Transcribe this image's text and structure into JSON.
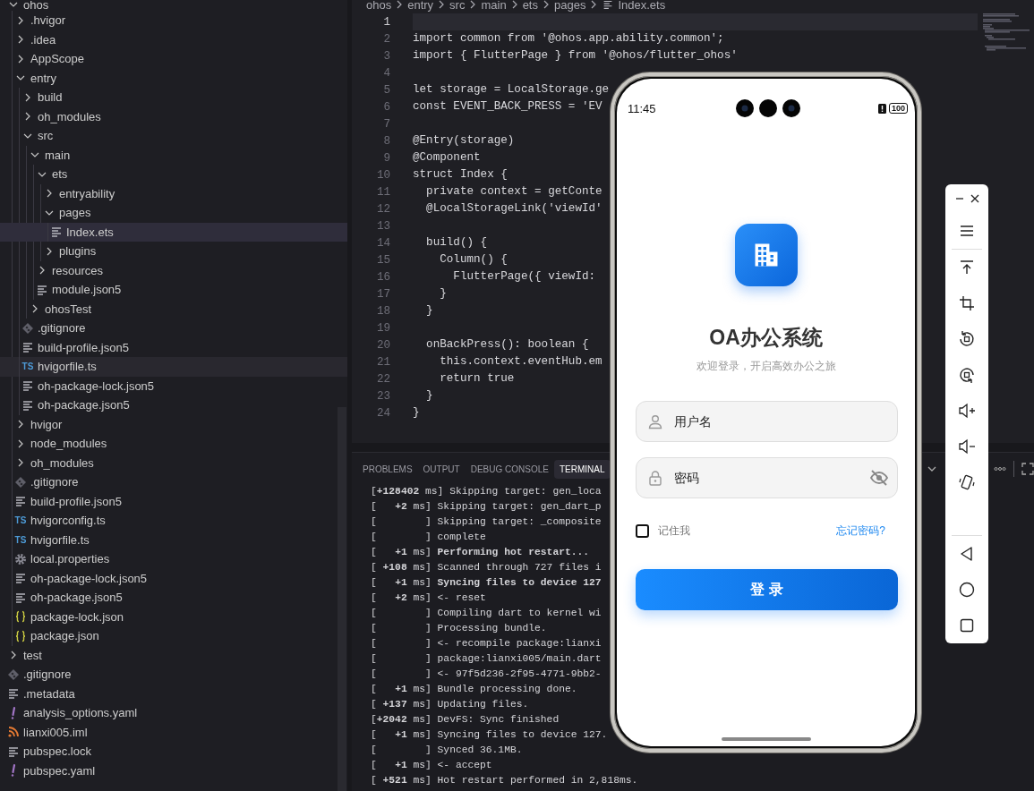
{
  "explorer": {
    "items": [
      {
        "name": "ohos",
        "kind": "folder",
        "expanded": true,
        "selected": false,
        "hovered": false,
        "children": [
          {
            "name": ".hvigor",
            "kind": "folder",
            "expanded": false,
            "selected": false,
            "hovered": false
          },
          {
            "name": ".idea",
            "kind": "folder",
            "expanded": false,
            "selected": false,
            "hovered": false
          },
          {
            "name": "AppScope",
            "kind": "folder",
            "expanded": false,
            "selected": false,
            "hovered": false
          },
          {
            "name": "entry",
            "kind": "folder",
            "expanded": true,
            "selected": false,
            "hovered": false,
            "children": [
              {
                "name": "build",
                "kind": "folder",
                "expanded": false,
                "selected": false,
                "hovered": false
              },
              {
                "name": "oh_modules",
                "kind": "folder",
                "expanded": false,
                "selected": false,
                "hovered": false
              },
              {
                "name": "src",
                "kind": "folder",
                "expanded": true,
                "selected": false,
                "hovered": false,
                "children": [
                  {
                    "name": "main",
                    "kind": "folder",
                    "expanded": true,
                    "selected": false,
                    "hovered": false,
                    "children": [
                      {
                        "name": "ets",
                        "kind": "folder",
                        "expanded": true,
                        "selected": false,
                        "hovered": false,
                        "children": [
                          {
                            "name": "entryability",
                            "kind": "folder",
                            "expanded": false,
                            "selected": false,
                            "hovered": false
                          },
                          {
                            "name": "pages",
                            "kind": "folder",
                            "expanded": true,
                            "selected": false,
                            "hovered": false,
                            "children": [
                              {
                                "name": "Index.ets",
                                "kind": "text",
                                "selected": true,
                                "hovered": false
                              }
                            ]
                          },
                          {
                            "name": "plugins",
                            "kind": "folder",
                            "expanded": false,
                            "selected": false,
                            "hovered": false
                          }
                        ]
                      },
                      {
                        "name": "resources",
                        "kind": "folder",
                        "expanded": false,
                        "selected": false,
                        "hovered": false
                      },
                      {
                        "name": "module.json5",
                        "kind": "text",
                        "selected": false,
                        "hovered": false
                      }
                    ]
                  },
                  {
                    "name": "ohosTest",
                    "kind": "folder",
                    "expanded": false,
                    "selected": false,
                    "hovered": false
                  }
                ]
              },
              {
                "name": ".gitignore",
                "kind": "git",
                "selected": false,
                "hovered": false
              },
              {
                "name": "build-profile.json5",
                "kind": "text",
                "selected": false,
                "hovered": false
              },
              {
                "name": "hvigorfile.ts",
                "kind": "typescript",
                "badge": "TS",
                "selected": false,
                "hovered": true
              },
              {
                "name": "oh-package-lock.json5",
                "kind": "text",
                "selected": false,
                "hovered": false
              },
              {
                "name": "oh-package.json5",
                "kind": "text",
                "selected": false,
                "hovered": false
              }
            ]
          },
          {
            "name": "hvigor",
            "kind": "folder",
            "expanded": false,
            "selected": false,
            "hovered": false
          },
          {
            "name": "node_modules",
            "kind": "folder",
            "expanded": false,
            "selected": false,
            "hovered": false
          },
          {
            "name": "oh_modules",
            "kind": "folder",
            "expanded": false,
            "selected": false,
            "hovered": false
          },
          {
            "name": ".gitignore",
            "kind": "git",
            "selected": false,
            "hovered": false
          },
          {
            "name": "build-profile.json5",
            "kind": "text",
            "selected": false,
            "hovered": false
          },
          {
            "name": "hvigorconfig.ts",
            "kind": "typescript",
            "badge": "TS",
            "selected": false,
            "hovered": false
          },
          {
            "name": "hvigorfile.ts",
            "kind": "typescript",
            "badge": "TS",
            "selected": false,
            "hovered": false
          },
          {
            "name": "local.properties",
            "kind": "settings",
            "selected": false,
            "hovered": false
          },
          {
            "name": "oh-package-lock.json5",
            "kind": "text",
            "selected": false,
            "hovered": false
          },
          {
            "name": "oh-package.json5",
            "kind": "text",
            "selected": false,
            "hovered": false
          },
          {
            "name": "package-lock.json",
            "kind": "json",
            "selected": false,
            "hovered": false
          },
          {
            "name": "package.json",
            "kind": "json",
            "selected": false,
            "hovered": false
          }
        ]
      },
      {
        "name": "test",
        "kind": "folder",
        "expanded": false,
        "selected": false,
        "hovered": false
      },
      {
        "name": ".gitignore",
        "kind": "git",
        "selected": false,
        "hovered": false
      },
      {
        "name": ".metadata",
        "kind": "text",
        "selected": false,
        "hovered": false
      },
      {
        "name": "analysis_options.yaml",
        "kind": "yaml",
        "selected": false,
        "hovered": false
      },
      {
        "name": "lianxi005.iml",
        "kind": "feed",
        "selected": false,
        "hovered": false
      },
      {
        "name": "pubspec.lock",
        "kind": "text",
        "selected": false,
        "hovered": false
      },
      {
        "name": "pubspec.yaml",
        "kind": "yaml",
        "selected": false,
        "hovered": false
      }
    ]
  },
  "editor": {
    "breadcrumb": [
      "ohos",
      "entry",
      "src",
      "main",
      "ets",
      "pages",
      "Index.ets"
    ],
    "lines": [
      {
        "number": "1",
        "current": true
      },
      {
        "number": "2",
        "text": "import common from '@ohos.app.ability.common';",
        "current": false
      },
      {
        "number": "3",
        "text": "import { FlutterPage } from '@ohos/flutter_ohos'",
        "current": false
      },
      {
        "number": "4",
        "current": false
      },
      {
        "number": "5",
        "text": "let storage = LocalStorage.ge",
        "current": false
      },
      {
        "number": "6",
        "text": "const EVENT_BACK_PRESS = 'EV",
        "current": false
      },
      {
        "number": "7",
        "current": false
      },
      {
        "number": "8",
        "text": "@Entry(storage)",
        "current": false
      },
      {
        "number": "9",
        "text": "@Component",
        "current": false
      },
      {
        "number": "10",
        "text": "struct Index {",
        "current": false
      },
      {
        "number": "11",
        "text": "  private context = getConte",
        "current": false
      },
      {
        "number": "12",
        "text": "  @LocalStorageLink('viewId'",
        "current": false
      },
      {
        "number": "13",
        "current": false
      },
      {
        "number": "14",
        "text": "  build() {",
        "current": false
      },
      {
        "number": "15",
        "text": "    Column() {",
        "current": false
      },
      {
        "number": "16",
        "text": "      FlutterPage({ viewId:",
        "current": false
      },
      {
        "number": "17",
        "text": "    }",
        "current": false
      },
      {
        "number": "18",
        "text": "  }",
        "current": false
      },
      {
        "number": "19",
        "current": false
      },
      {
        "number": "20",
        "text": "  onBackPress(): boolean {",
        "current": false
      },
      {
        "number": "21",
        "text": "    this.context.eventHub.em",
        "current": false
      },
      {
        "number": "22",
        "text": "    return true",
        "current": false
      },
      {
        "number": "23",
        "text": "  }",
        "current": false
      },
      {
        "number": "24",
        "text": "}",
        "current": false
      }
    ]
  },
  "panel": {
    "tabs": [
      {
        "label": "PROBLEMS",
        "selected": false
      },
      {
        "label": "OUTPUT",
        "selected": false
      },
      {
        "label": "DEBUG CONSOLE",
        "selected": false
      },
      {
        "label": "TERMINAL",
        "selected": true
      }
    ],
    "terminal": [
      "[**+128402** ms] Skipping target: gen_loca",
      "[   **+2** ms] Skipping target: gen_dart_p",
      "[        ] Skipping target: _composite",
      "[        ] complete",
      "[   **+1** ms] **Performing hot restart...**",
      "[ **+108** ms] Scanned through 727 files i",
      "[   **+1** ms] **Syncing files to device 127**",
      "[   **+2** ms] <- reset",
      "[        ] Compiling dart to kernel wi",
      "[        ] Processing bundle.",
      "[        ] <- recompile package:lianxi",
      "[        ] package:lianxi005/main.dart",
      "[        ] <- 97f5d236-2f95-4771-9bb2-",
      "[   **+1** ms] Bundle processing done.",
      "[ **+137** ms] Updating files.",
      "[**+2042** ms] DevFS: Sync finished",
      "[   **+1** ms] Syncing files to device 127.",
      "[        ] Synced 36.1MB.",
      "[   **+1** ms] <- accept",
      "[ **+521** ms] Hot restart performed in 2,818ms."
    ]
  },
  "phone": {
    "status_bar": {
      "time": "11:45",
      "battery": "100"
    },
    "app": {
      "title": "OA办公系统",
      "subtitle": "欢迎登录，开启高效办公之旅",
      "username": {
        "placeholder": "用户名"
      },
      "password": {
        "placeholder": "密码",
        "visible": false
      },
      "remember": {
        "label": "记住我",
        "checked": false
      },
      "forgot_link": "忘记密码?",
      "login_button": "登 录"
    }
  }
}
